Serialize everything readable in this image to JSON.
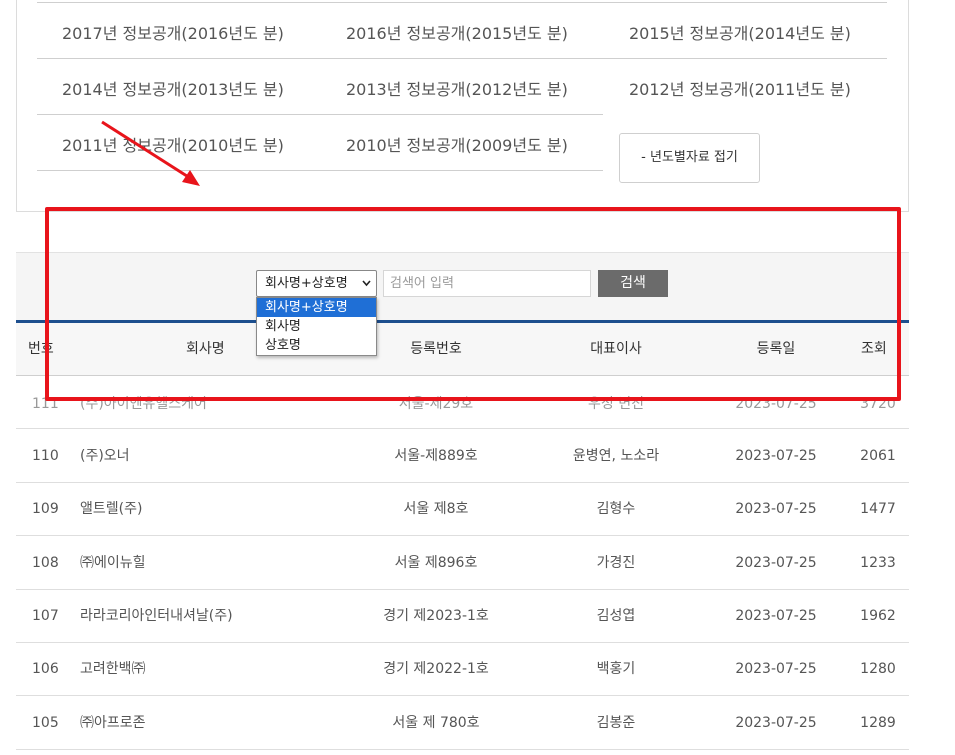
{
  "year_links": [
    [
      "2017년 정보공개(2016년도 분)",
      "2016년 정보공개(2015년도 분)",
      "2015년 정보공개(2014년도 분)"
    ],
    [
      "2014년 정보공개(2013년도 분)",
      "2013년 정보공개(2012년도 분)",
      "2012년 정보공개(2011년도 분)"
    ],
    [
      "2011년 정보공개(2010년도 분)",
      "2010년 정보공개(2009년도 분)"
    ]
  ],
  "fold_button": "- 년도별자료 접기",
  "search": {
    "selected": "회사명+상호명",
    "placeholder": "검색어 입력",
    "button": "검색",
    "options": [
      "회사명+상호명",
      "회사명",
      "상호명"
    ]
  },
  "table": {
    "headers": [
      "번호",
      "회사명",
      "등록번호",
      "대표이사",
      "등록일",
      "조회"
    ],
    "rows": [
      [
        "111",
        "(주)아이엔유헬스케어",
        "서울-제29호",
        "우정 변진",
        "2023-07-25",
        "3720"
      ],
      [
        "110",
        "(주)오너",
        "서울-제889호",
        "윤병연, 노소라",
        "2023-07-25",
        "2061"
      ],
      [
        "109",
        "앨트렐(주)",
        "서울 제8호",
        "김형수",
        "2023-07-25",
        "1477"
      ],
      [
        "108",
        "㈜에이뉴힐",
        "서울 제896호",
        "가경진",
        "2023-07-25",
        "1233"
      ],
      [
        "107",
        "라라코리아인터내셔날(주)",
        "경기 제2023-1호",
        "김성엽",
        "2023-07-25",
        "1962"
      ],
      [
        "106",
        "고려한백㈜",
        "경기 제2022-1호",
        "백홍기",
        "2023-07-25",
        "1280"
      ],
      [
        "105",
        "㈜아프로존",
        "서울 제 780호",
        "김봉준",
        "2023-07-25",
        "1289"
      ]
    ]
  },
  "annotation_color": "#e8141b",
  "accent_color": "#1d4f8e"
}
